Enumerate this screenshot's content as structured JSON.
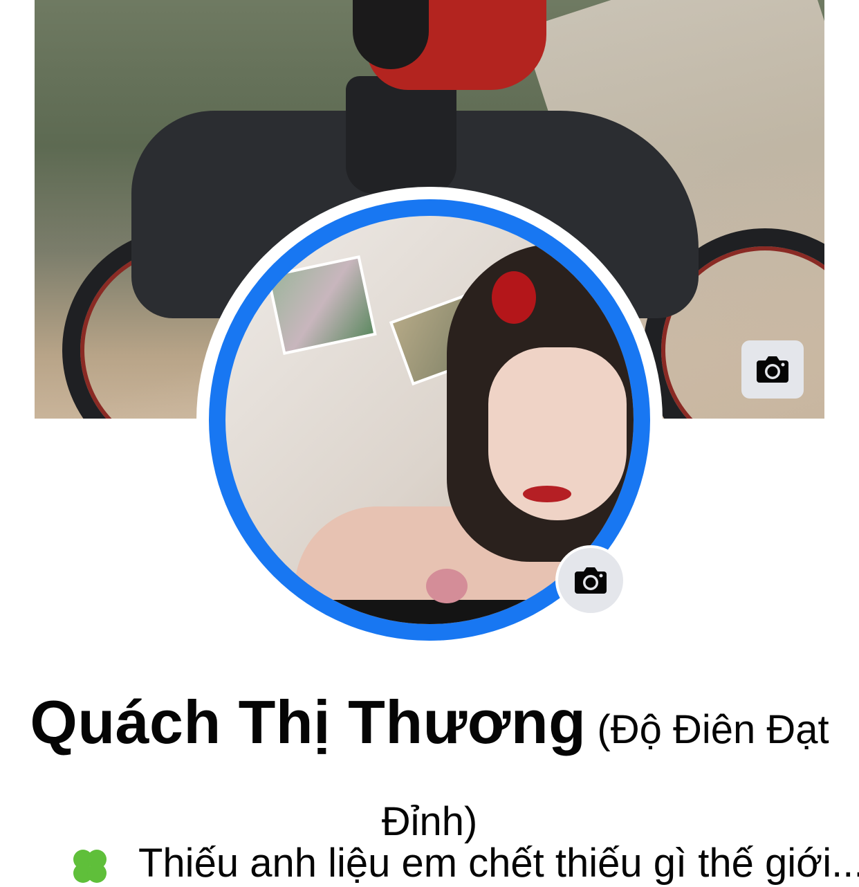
{
  "profile": {
    "name": "Quách Thị Thương",
    "alternate_name": "(Độ Điên Đạt Đỉnh)",
    "bio_partial": "Thiếu anh liệu em chết thiếu gì thế giới..."
  },
  "buttons": {
    "cover_camera": "camera-icon",
    "avatar_camera": "camera-icon"
  },
  "colors": {
    "avatar_ring": "#1877f2",
    "camera_bg": "#e4e6eb",
    "text": "#050505"
  }
}
